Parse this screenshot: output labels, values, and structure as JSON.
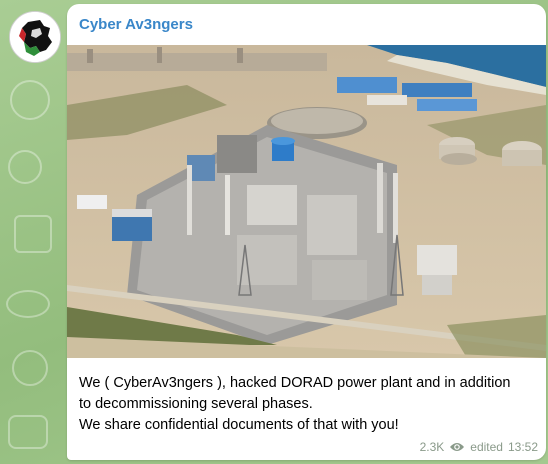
{
  "channel": {
    "name": "Cyber Av3ngers",
    "avatar_icon": "cyber-avengers-logo-icon"
  },
  "post": {
    "photo_icon": "power-plant-aerial-photo",
    "caption_lines": [
      "We ( CyberAv3ngers ), hacked DORAD power plant and in addition",
      "to decommissioning several phases.",
      "We share confidential documents of that with you!"
    ],
    "views": "2.3K",
    "views_icon": "eye-icon",
    "edited_label": "edited",
    "time": "13:52"
  },
  "colors": {
    "chat_background": "#9ec48a",
    "channel_name": "#3a87c9",
    "meta_text": "#8a9a8a"
  }
}
